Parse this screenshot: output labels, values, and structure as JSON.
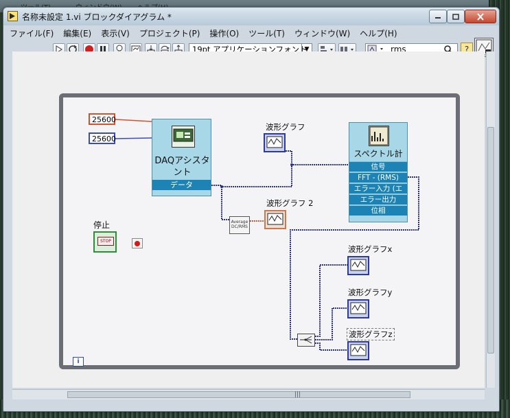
{
  "background": {
    "ghost_menu_1": "ツール(T)",
    "ghost_menu_2": "ウィンドウ(W)",
    "ghost_menu_3": "ヘルプ(H)"
  },
  "window": {
    "title": "名称未設定 1.vi ブロックダイアグラム *"
  },
  "menu": [
    "ファイル(F)",
    "編集(E)",
    "表示(V)",
    "プロジェクト(P)",
    "操作(O)",
    "ツール(T)",
    "ウィンドウ(W)",
    "ヘルプ(H)"
  ],
  "toolbar": {
    "font_selector": "19pt アプリケーションフォント",
    "search_value": "rms",
    "help_label": "?"
  },
  "diagram": {
    "constant_1": "25600",
    "constant_2": "25600",
    "daq_assistant": {
      "title": "DAQアシスタント",
      "output": "データ"
    },
    "graph_labels": {
      "graph_1": "波形グラフ",
      "graph_2": "波形グラフ 2",
      "graph_x": "波形グラフx",
      "graph_y": "波形グラフy",
      "graph_z": "波形グラフz"
    },
    "spectral": {
      "title": "スペクトル計",
      "rows": [
        "信号",
        "FFT - (RMS)",
        "エラー入力 (エ",
        "エラー出力",
        "位相"
      ]
    },
    "stop_label": "停止",
    "stop_button_text": "STOP",
    "avg_node_text": "Average DC/RMS",
    "iteration_terminal": "i"
  },
  "colors": {
    "daq_node": "#a8d8e8",
    "express_row": "#1d83b5",
    "wire_waveform": "#2b2f8f",
    "wire_orange": "#d2512f",
    "loop_border": "#6b6e75"
  }
}
